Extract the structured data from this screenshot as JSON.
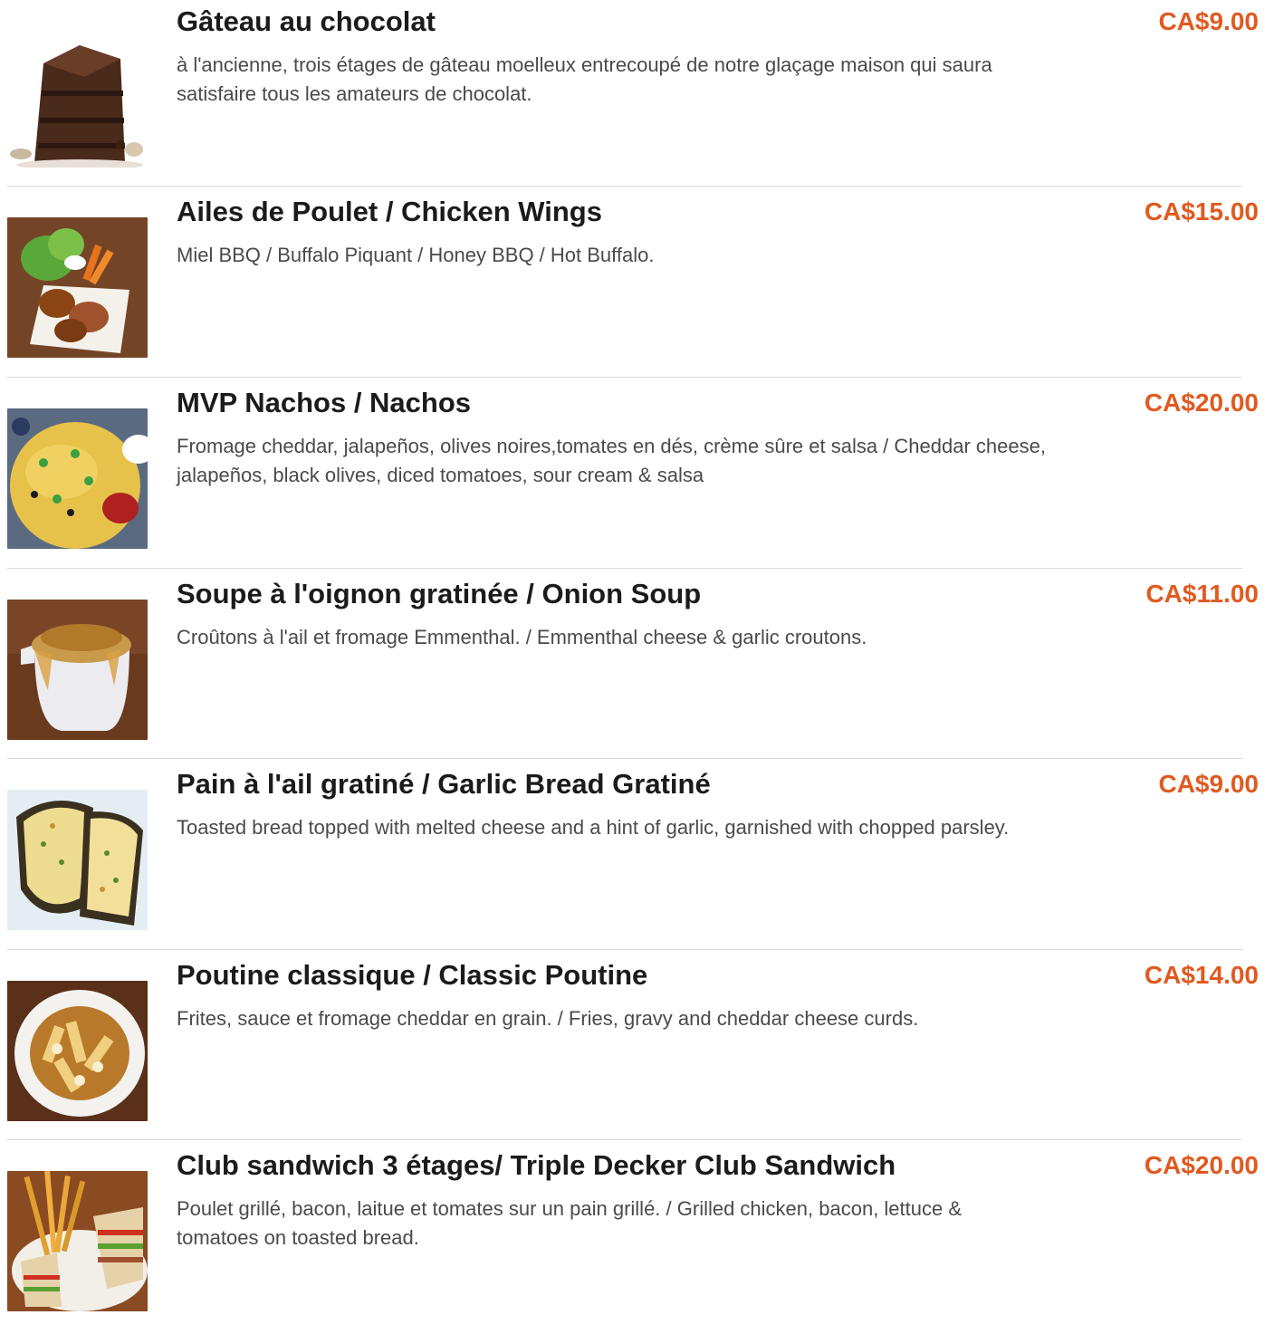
{
  "colors": {
    "price": "#e05a20",
    "title": "#1b1b1b",
    "description": "#4a4a4a",
    "divider": "#d8d8d8"
  },
  "items": [
    {
      "name": "Gâteau au chocolat",
      "description": "à l'ancienne, trois étages de gâteau moelleux entrecoupé de notre glaçage maison qui saura satisfaire tous les amateurs de chocolat.",
      "price": "CA$9.00",
      "image_icon": "chocolate-cake-photo"
    },
    {
      "name": "Ailes de Poulet / Chicken Wings",
      "description": "Miel BBQ / Buffalo Piquant / Honey BBQ / Hot Buffalo.",
      "price": "CA$15.00",
      "image_icon": "chicken-wings-photo"
    },
    {
      "name": "MVP Nachos / Nachos",
      "description": "Fromage cheddar, jalapeños, olives noires,tomates en dés, crème sûre et salsa / Cheddar cheese, jalapeños, black olives, diced tomatoes, sour cream & salsa",
      "price": "CA$20.00",
      "image_icon": "nachos-photo"
    },
    {
      "name": "Soupe à l'oignon gratinée / Onion Soup",
      "description": "Croûtons à l'ail et fromage Emmenthal. / Emmenthal cheese & garlic croutons.",
      "price": "CA$11.00",
      "image_icon": "onion-soup-photo"
    },
    {
      "name": "Pain à l'ail gratiné / Garlic Bread Gratiné",
      "description": "Toasted bread topped with melted cheese and a hint of garlic, garnished with chopped parsley.",
      "price": "CA$9.00",
      "image_icon": "garlic-bread-photo"
    },
    {
      "name": "Poutine classique / Classic Poutine",
      "description": "Frites, sauce et fromage cheddar en grain. / Fries, gravy and cheddar cheese curds.",
      "price": "CA$14.00",
      "image_icon": "poutine-photo"
    },
    {
      "name": "Club sandwich 3 étages/ Triple Decker Club Sandwich",
      "description": "Poulet grillé, bacon, laitue et tomates sur un pain grillé. / Grilled chicken, bacon, lettuce & tomatoes on toasted bread.",
      "price": "CA$20.00",
      "image_icon": "club-sandwich-photo"
    }
  ]
}
